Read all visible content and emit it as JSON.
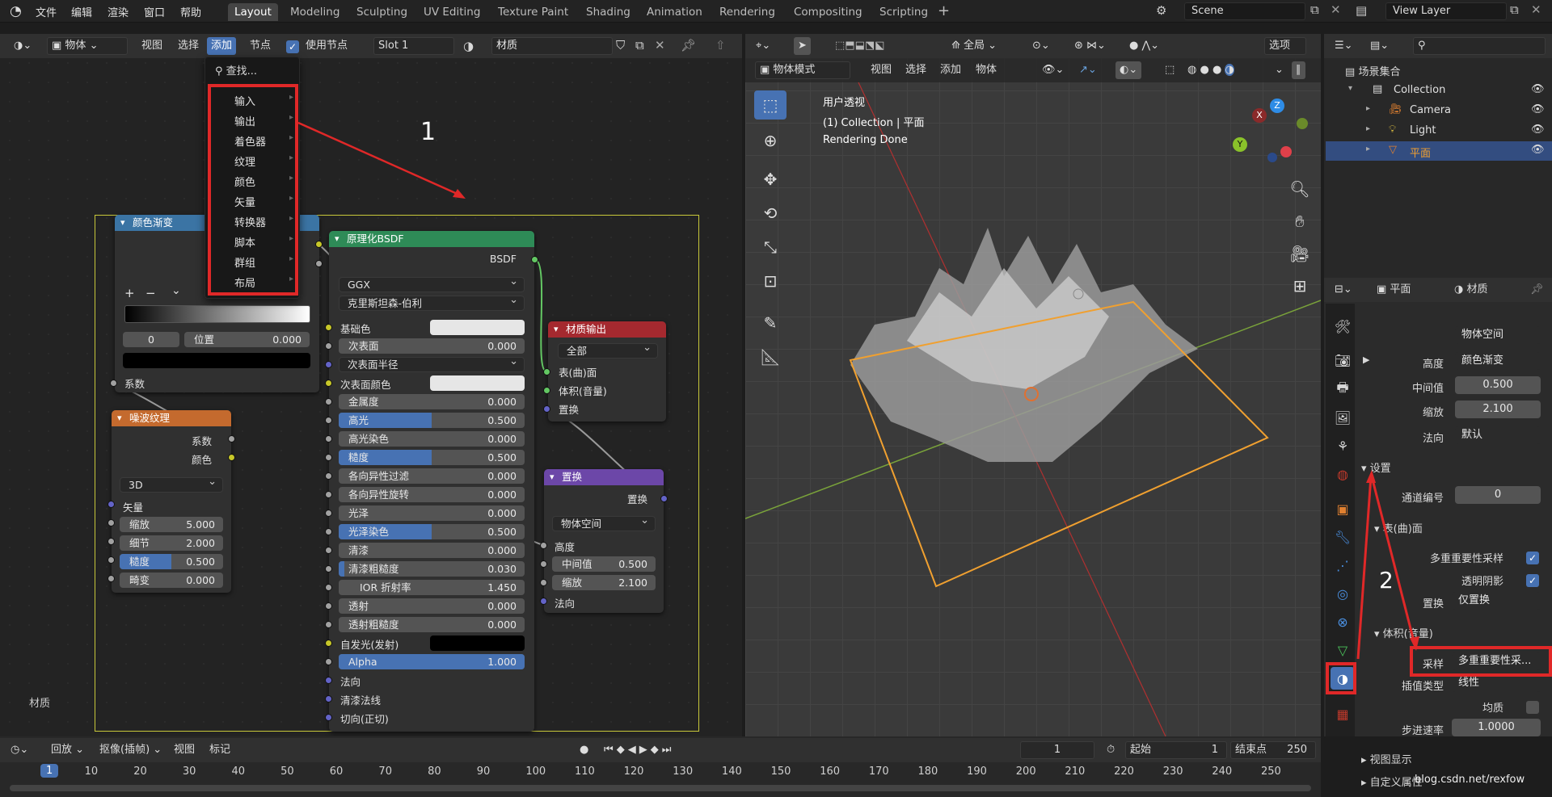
{
  "topbar": {
    "menus": [
      "文件",
      "编辑",
      "渲染",
      "窗口",
      "帮助"
    ],
    "workspaces": [
      "Layout",
      "Modeling",
      "Sculpting",
      "UV Editing",
      "Texture Paint",
      "Shading",
      "Animation",
      "Rendering",
      "Compositing",
      "Scripting"
    ],
    "active_workspace": "Layout",
    "add_tab": "+",
    "scene": "Scene",
    "view_layer": "View Layer"
  },
  "node_editor": {
    "header": {
      "object_select": "物体",
      "view": "视图",
      "select": "选择",
      "add": "添加",
      "node": "节点",
      "use_nodes": "使用节点",
      "slot": "Slot 1",
      "material": "材质"
    },
    "editor_label": "材质",
    "add_menu": {
      "search": "查找...",
      "items": [
        "输入",
        "输出",
        "着色器",
        "纹理",
        "颜色",
        "矢量",
        "转换器",
        "脚本",
        "群组",
        "布局"
      ]
    },
    "annotation_1": "1",
    "nodes": {
      "color_ramp": {
        "title": "颜色渐变",
        "plus": "+",
        "minus": "−",
        "chevron": "⌄",
        "index": "0",
        "pos_label": "位置",
        "pos_value": "0.000",
        "output": "系数"
      },
      "noise": {
        "title": "噪波纹理",
        "out_fac": "系数",
        "out_color": "颜色",
        "dim": "3D",
        "vector": "矢量",
        "scale_label": "缩放",
        "scale": "5.000",
        "detail_label": "细节",
        "detail": "2.000",
        "rough_label": "糙度",
        "rough": "0.500",
        "distort_label": "畸变",
        "distort": "0.000"
      },
      "bsdf": {
        "title": "原理化BSDF",
        "out": "BSDF",
        "dist": "GGX",
        "sss_method": "克里斯坦森-伯利",
        "rows": [
          {
            "label": "基础色",
            "type": "color",
            "color": "#e6e6e6",
            "socket": "y"
          },
          {
            "label": "次表面",
            "value": "0.000",
            "type": "slider",
            "fill": 0,
            "socket": "gr"
          },
          {
            "label": "次表面半径",
            "type": "dd",
            "socket": "b"
          },
          {
            "label": "次表面颜色",
            "type": "color",
            "color": "#e6e6e6",
            "socket": "y"
          },
          {
            "label": "金属度",
            "value": "0.000",
            "type": "slider",
            "fill": 0,
            "socket": "gr"
          },
          {
            "label": "高光",
            "value": "0.500",
            "type": "slider",
            "fill": 0.5,
            "socket": "gr"
          },
          {
            "label": "高光染色",
            "value": "0.000",
            "type": "slider",
            "fill": 0,
            "socket": "gr"
          },
          {
            "label": "糙度",
            "value": "0.500",
            "type": "slider",
            "fill": 0.5,
            "socket": "gr"
          },
          {
            "label": "各向异性过滤",
            "value": "0.000",
            "type": "slider",
            "fill": 0,
            "socket": "gr"
          },
          {
            "label": "各向异性旋转",
            "value": "0.000",
            "type": "slider",
            "fill": 0,
            "socket": "gr"
          },
          {
            "label": "光泽",
            "value": "0.000",
            "type": "slider",
            "fill": 0,
            "socket": "gr"
          },
          {
            "label": "光泽染色",
            "value": "0.500",
            "type": "slider",
            "fill": 0.5,
            "socket": "gr"
          },
          {
            "label": "清漆",
            "value": "0.000",
            "type": "slider",
            "fill": 0,
            "socket": "gr"
          },
          {
            "label": "清漆粗糙度",
            "value": "0.030",
            "type": "slider",
            "fill": 0.03,
            "socket": "gr"
          },
          {
            "label": "IOR 折射率",
            "value": "1.450",
            "type": "slider",
            "fill": 0,
            "center": true,
            "socket": "gr"
          },
          {
            "label": "透射",
            "value": "0.000",
            "type": "slider",
            "fill": 0,
            "socket": "gr"
          },
          {
            "label": "透射粗糙度",
            "value": "0.000",
            "type": "slider",
            "fill": 0,
            "socket": "gr"
          },
          {
            "label": "自发光(发射)",
            "type": "color",
            "color": "#000000",
            "socket": "y"
          },
          {
            "label": "Alpha",
            "value": "1.000",
            "type": "slider",
            "fill": 1,
            "socket": "gr"
          },
          {
            "label": "法向",
            "type": "socket",
            "socket": "b"
          },
          {
            "label": "清漆法线",
            "type": "socket",
            "socket": "b"
          },
          {
            "label": "切向(正切)",
            "type": "socket",
            "socket": "b"
          }
        ]
      },
      "output": {
        "title": "材质输出",
        "target": "全部",
        "surface": "表(曲)面",
        "volume": "体积(音量)",
        "displacement": "置换"
      },
      "displacement": {
        "title": "置换",
        "out": "置换",
        "space": "物体空间",
        "height": "高度",
        "mid_label": "中间值",
        "mid": "0.500",
        "scale_label": "缩放",
        "scale": "2.100",
        "normal": "法向"
      }
    }
  },
  "viewport": {
    "mode": "物体模式",
    "menus": [
      "视图",
      "选择",
      "添加",
      "物体"
    ],
    "orientation": "全局",
    "options": "选项",
    "overlay_text": [
      "用户透视",
      "(1) Collection | 平面",
      "Rendering Done"
    ],
    "gizmo": {
      "x": "X",
      "y": "Y",
      "z": "Z"
    }
  },
  "outliner": {
    "root": "场景集合",
    "items": [
      {
        "name": "Collection",
        "icon": "collection-icon"
      },
      {
        "name": "Camera",
        "icon": "camera-icon"
      },
      {
        "name": "Light",
        "icon": "light-icon"
      },
      {
        "name": "平面",
        "icon": "mesh-icon"
      }
    ]
  },
  "properties": {
    "header_object": "平面",
    "header_material": "材质",
    "rows": {
      "space_value": "物体空间",
      "height_label": "高度",
      "height_value": "颜色渐变",
      "mid_label": "中间值",
      "mid_value": "0.500",
      "scale_label": "缩放",
      "scale_value": "2.100",
      "normal_label": "法向",
      "normal_value": "默认"
    },
    "settings": {
      "title": "设置",
      "pass_label": "通道编号",
      "pass_value": "0",
      "surface_title": "表(曲)面",
      "mis_label": "多重重要性采样",
      "transp_label": "透明阴影",
      "disp_label": "置换",
      "disp_value": "仅置换",
      "volume_title": "体积(音量)",
      "sampling_label": "采样",
      "sampling_value": "多重重要性采...",
      "interp_label": "插值类型",
      "interp_value": "线性",
      "homog_label": "均质",
      "step_label": "步进速率",
      "step_value": "1.0000",
      "viewport_title": "视图显示",
      "custom_title": "自定义属性"
    },
    "annotation_2": "2"
  },
  "timeline": {
    "playback": "回放",
    "keying": "抠像(插帧)",
    "view": "视图",
    "marker": "标记",
    "current_frame": "1",
    "start_label": "起始",
    "start": "1",
    "end_label": "结束点",
    "end": "250",
    "ticks": [
      "1",
      "10",
      "20",
      "30",
      "40",
      "50",
      "60",
      "70",
      "80",
      "90",
      "100",
      "110",
      "120",
      "130",
      "140",
      "150",
      "160",
      "170",
      "180",
      "190",
      "200",
      "210",
      "220",
      "230",
      "240",
      "250"
    ]
  },
  "watermark": "blog.csdn.net/rexfow",
  "colors": {
    "accent": "#4772b3",
    "annotation": "#e02828",
    "selection_orange": "#f0a030"
  }
}
